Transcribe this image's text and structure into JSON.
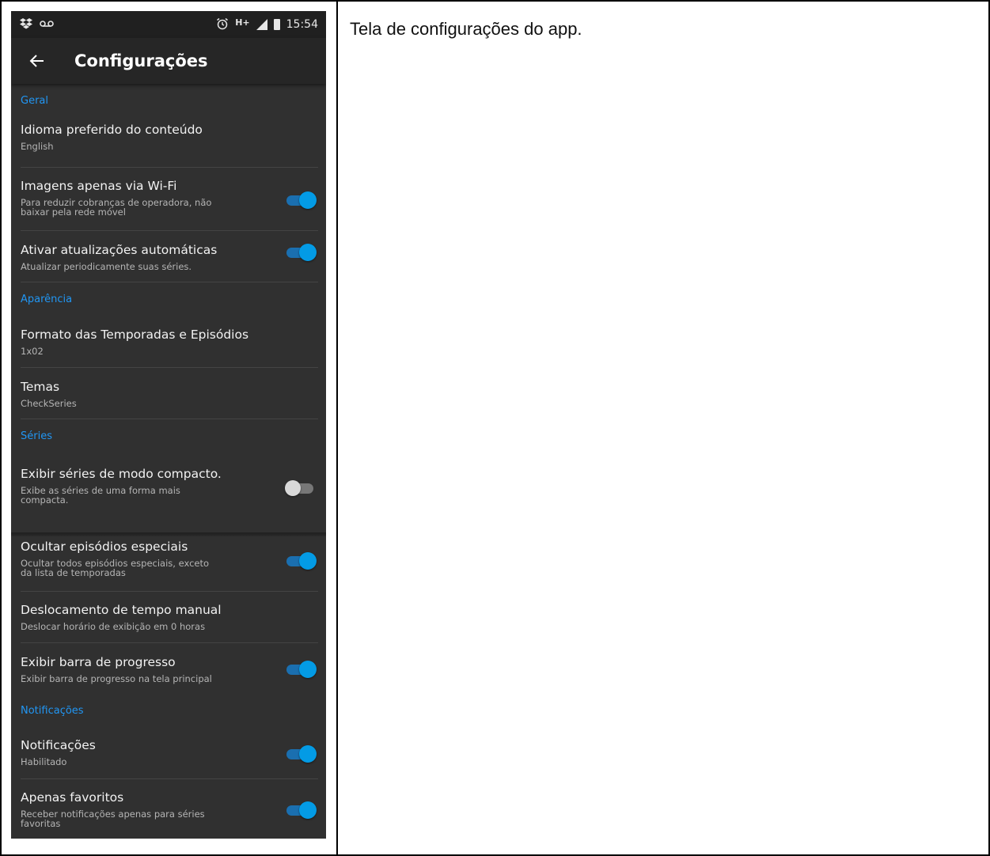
{
  "caption": "Tela de configurações do app.",
  "statusbar": {
    "time": "15:54",
    "network": "H+"
  },
  "appbar": {
    "title": "Configurações"
  },
  "colors": {
    "accent": "#2196f3",
    "toggle_on": "#039be5",
    "background": "#303030",
    "toolbar": "#262626"
  },
  "sections": [
    {
      "header": "Geral"
    },
    {
      "header": "Aparência"
    },
    {
      "header": "Séries"
    },
    {
      "header": "Notificações"
    }
  ],
  "items": [
    {
      "title": "Idioma preferido do conteúdo",
      "summary": "English"
    },
    {
      "title": "Imagens apenas via Wi-Fi",
      "summary": "Para reduzir cobranças de operadora, não baixar pela rede móvel",
      "toggle": true
    },
    {
      "title": "Ativar atualizações automáticas",
      "summary": "Atualizar periodicamente suas séries.",
      "toggle": true
    },
    {
      "title": "Formato das Temporadas e Episódios",
      "summary": "1x02"
    },
    {
      "title": "Temas",
      "summary": "CheckSeries"
    },
    {
      "title": "Exibir séries de modo compacto.",
      "summary": "Exibe as séries de uma forma mais compacta.",
      "toggle": false
    },
    {
      "title": "Ocultar episódios especiais",
      "summary": "Ocultar todos episódios especiais, exceto da lista de temporadas",
      "toggle": true
    },
    {
      "title": "Deslocamento de tempo manual",
      "summary": "Deslocar horário de exibição em 0 horas"
    },
    {
      "title": "Exibir barra de progresso",
      "summary": "Exibir barra de progresso na tela principal",
      "toggle": true
    },
    {
      "title": "Notificações",
      "summary": "Habilitado",
      "toggle": true
    },
    {
      "title": "Apenas favoritos",
      "summary": "Receber notificações apenas para séries favoritas",
      "toggle": true
    }
  ]
}
